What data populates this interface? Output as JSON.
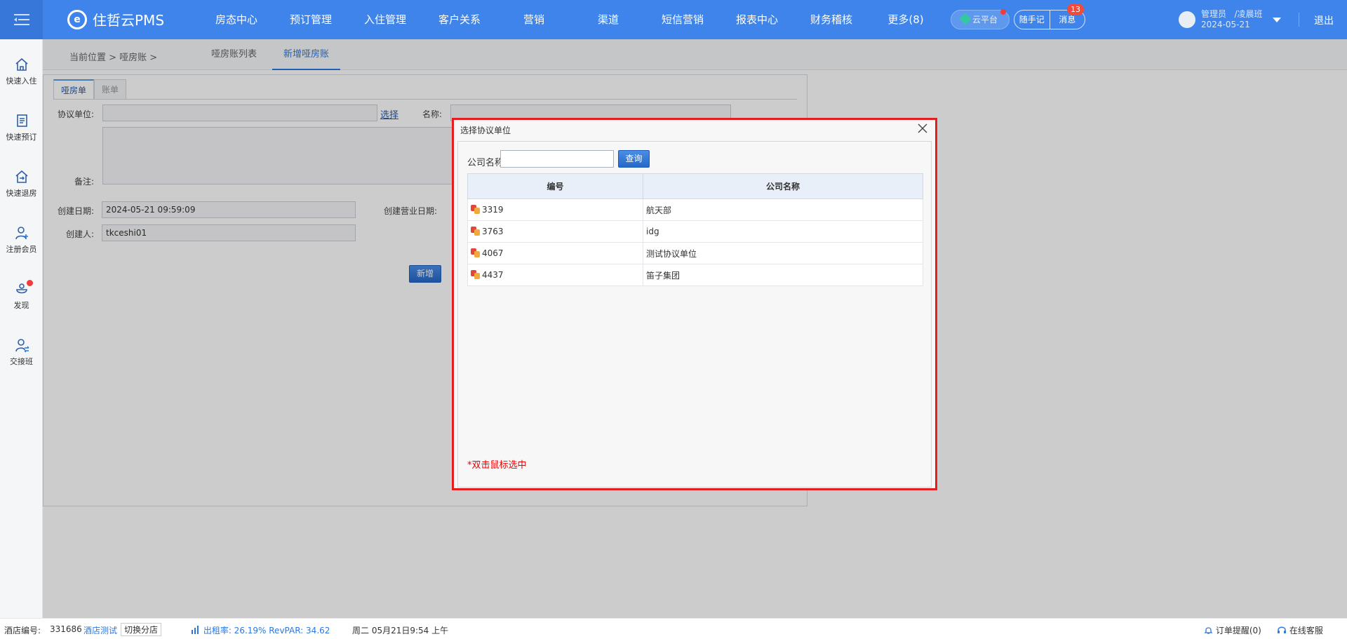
{
  "app": {
    "brand": "住哲云PMS"
  },
  "nav": [
    "房态中心",
    "预订管理",
    "入住管理",
    "客户关系",
    "营销",
    "渠道",
    "短信营销",
    "报表中心",
    "财务稽核",
    "更多(8)"
  ],
  "header": {
    "cloud": "云平台",
    "notes": "随手记",
    "messages": "消息",
    "message_count": "13",
    "user_role": "管理员",
    "user_shift": "/凌晨班",
    "user_date": "2024-05-21",
    "logout": "退出"
  },
  "sidebar": [
    {
      "label": "快速入住",
      "icon": "home-icon"
    },
    {
      "label": "快速预订",
      "icon": "clipboard-icon"
    },
    {
      "label": "快速退房",
      "icon": "checkout-icon"
    },
    {
      "label": "注册会员",
      "icon": "user-add-icon"
    },
    {
      "label": "发现",
      "icon": "discover-icon"
    },
    {
      "label": "交接班",
      "icon": "shift-exchange-icon"
    }
  ],
  "breadcrumb": {
    "location": "当前位置  >  哑房账  >",
    "tabs": [
      "哑房账列表",
      "新增哑房账"
    ]
  },
  "form": {
    "tabs": [
      "哑房单",
      "账单"
    ],
    "agreement_label": "协议单位:",
    "select_link": "选择",
    "name_label": "名称:",
    "note_label": "备注:",
    "created_date_label": "创建日期:",
    "created_date_value": "2024-05-21 09:59:09",
    "business_date_label": "创建营业日期:",
    "creator_label": "创建人:",
    "creator_value": "tkceshi01",
    "add_button": "新增"
  },
  "modal": {
    "title": "选择协议单位",
    "search_label": "公司名称:",
    "search_value": "",
    "query_button": "查询",
    "columns": [
      "编号",
      "公司名称"
    ],
    "rows": [
      {
        "code": "3319",
        "name": "航天部"
      },
      {
        "code": "3763",
        "name": "idg"
      },
      {
        "code": "4067",
        "name": "测试协议单位"
      },
      {
        "code": "4437",
        "name": "笛子集团"
      }
    ],
    "tip": "*双击鼠标选中"
  },
  "status": {
    "hotel_no_label": "酒店编号:",
    "hotel_no": "331686",
    "hotel_name": "酒店测试",
    "switch_store": "切换分店",
    "occupancy": "出租率:  26.19%  RevPAR:  34.62",
    "datetime": "周二 05月21日9:54 上午",
    "order_alert": "订单提醒(0)",
    "online_service": "在线客服"
  },
  "colors": {
    "topbar": "#3f84ea",
    "modal_border": "#e41e1e",
    "primary_button": "#2568c9",
    "tip": "#e60000"
  }
}
